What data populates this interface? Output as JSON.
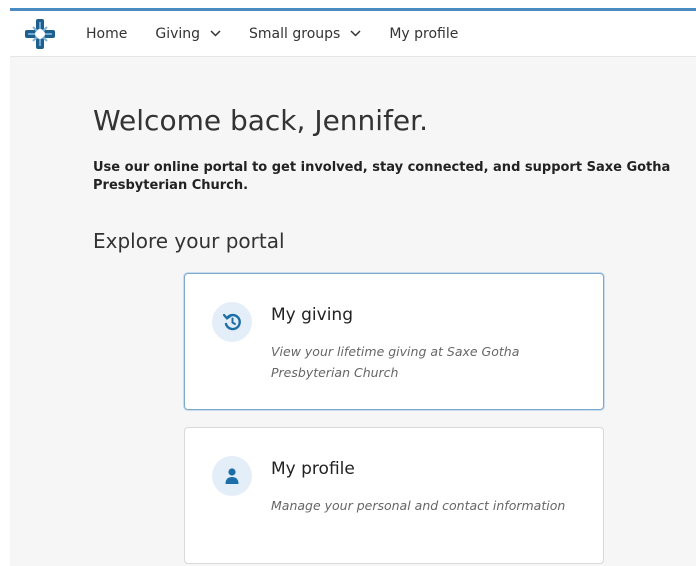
{
  "nav": {
    "logo_icon": "church-cross-logo",
    "items": [
      {
        "label": "Home",
        "has_dropdown": false
      },
      {
        "label": "Giving",
        "has_dropdown": true
      },
      {
        "label": "Small groups",
        "has_dropdown": true
      },
      {
        "label": "My profile",
        "has_dropdown": false
      }
    ]
  },
  "main": {
    "welcome": "Welcome back, Jennifer.",
    "intro": "Use our online portal to get involved, stay connected, and support Saxe Gotha Presbyterian Church.",
    "explore_heading": "Explore your portal",
    "cards": [
      {
        "icon": "history-icon",
        "title": "My giving",
        "description": "View your lifetime giving at Saxe Gotha Presbyterian Church"
      },
      {
        "icon": "person-icon",
        "title": "My profile",
        "description": "Manage your personal and contact information"
      }
    ]
  },
  "colors": {
    "accent": "#4a8bc4",
    "icon_primary": "#1e6fa8",
    "icon_bg": "#e3eef8",
    "page_bg": "#f6f6f6"
  }
}
